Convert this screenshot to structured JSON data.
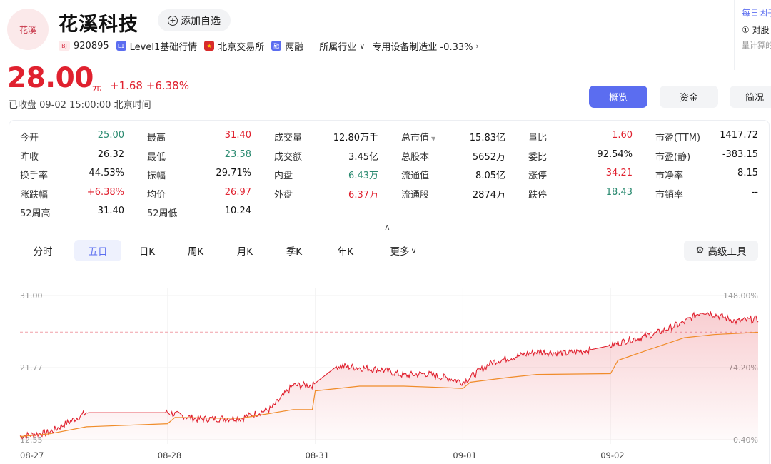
{
  "header": {
    "logo_text": "花溪",
    "name": "花溪科技",
    "watch_label": "添加自选",
    "meta": {
      "exchange_badge": "BJ",
      "code": "920895",
      "level_badge": "L1",
      "level": "Level1基础行情",
      "market": "北京交易所",
      "margin_badge": "融",
      "margin": "两融",
      "industry_label": "所属行业",
      "industry": "专用设备制造业 -0.33%"
    }
  },
  "right_panel": {
    "title": "每日因子",
    "line": "① 对股",
    "sub": "量计算的"
  },
  "quote": {
    "price": "28.00",
    "unit": "元",
    "change": "+1.68",
    "change_pct": "+6.38%",
    "status": "已收盘",
    "time": "09-02 15:00:00 北京时间"
  },
  "tabs": {
    "overview": "概览",
    "funds": "资金",
    "brief": "简况"
  },
  "stats": {
    "col1": [
      {
        "label": "今开",
        "value": "25.00",
        "color": "green"
      },
      {
        "label": "昨收",
        "value": "26.32",
        "color": ""
      },
      {
        "label": "换手率",
        "value": "44.53%",
        "color": ""
      },
      {
        "label": "涨跌幅",
        "value": "+6.38%",
        "color": "red"
      },
      {
        "label": "52周高",
        "value": "31.40",
        "color": ""
      }
    ],
    "col2": [
      {
        "label": "最高",
        "value": "31.40",
        "color": "red"
      },
      {
        "label": "最低",
        "value": "23.58",
        "color": "green"
      },
      {
        "label": "振幅",
        "value": "29.71%",
        "color": ""
      },
      {
        "label": "均价",
        "value": "26.97",
        "color": "red"
      },
      {
        "label": "52周低",
        "value": "10.24",
        "color": ""
      }
    ],
    "col3": [
      {
        "label": "成交量",
        "value": "12.80万手",
        "color": ""
      },
      {
        "label": "成交额",
        "value": "3.45亿",
        "color": ""
      },
      {
        "label": "内盘",
        "value": "6.43万",
        "color": "green"
      },
      {
        "label": "外盘",
        "value": "6.37万",
        "color": "red"
      }
    ],
    "col4": [
      {
        "label": "总市值",
        "value": "15.83亿",
        "color": ""
      },
      {
        "label": "总股本",
        "value": "5652万",
        "color": ""
      },
      {
        "label": "流通值",
        "value": "8.05亿",
        "color": ""
      },
      {
        "label": "流通股",
        "value": "2874万",
        "color": ""
      }
    ],
    "col5": [
      {
        "label": "量比",
        "value": "1.60",
        "color": "red"
      },
      {
        "label": "委比",
        "value": "92.54%",
        "color": ""
      },
      {
        "label": "涨停",
        "value": "34.21",
        "color": "red"
      },
      {
        "label": "跌停",
        "value": "18.43",
        "color": "green"
      }
    ],
    "col6": [
      {
        "label": "市盈(TTM)",
        "value": "1417.72",
        "color": ""
      },
      {
        "label": "市盈(静)",
        "value": "-383.15",
        "color": ""
      },
      {
        "label": "市净率",
        "value": "8.15",
        "color": ""
      },
      {
        "label": "市销率",
        "value": "--",
        "color": ""
      }
    ]
  },
  "period_tabs": [
    "分时",
    "五日",
    "日K",
    "周K",
    "月K",
    "季K",
    "年K",
    "更多"
  ],
  "active_period": "五日",
  "advanced_tools": "高级工具",
  "colors": {
    "up": "#e0212f",
    "down": "#2a8a70",
    "accent": "#5b6df0",
    "avg_line": "#f08c2a"
  },
  "chart_data": {
    "type": "line",
    "ylim": [
      12.55,
      31.0
    ],
    "y_ticks": [
      "31.00",
      "21.77",
      "12.55"
    ],
    "y2_ticks": [
      "148.00%",
      "74.20%",
      "0.40%"
    ],
    "x_labels": [
      "08-27",
      "08-28",
      "08-31",
      "09-01",
      "09-02"
    ],
    "prev_close": 26.32,
    "series": [
      {
        "key": "price",
        "x": [
          0,
          0.2,
          0.45,
          0.6,
          0.75,
          0.9,
          1.0,
          1.2,
          1.5,
          1.7,
          1.85,
          1.98,
          2.15,
          2.45,
          2.6,
          2.75,
          2.85,
          2.95,
          3.0,
          3.2,
          3.5,
          3.7,
          3.85,
          4.0,
          4.1,
          4.3,
          4.5,
          4.62,
          4.7,
          4.85,
          5.0
        ],
        "values": [
          13.0,
          13.5,
          16.0,
          16.0,
          16.0,
          16.0,
          16.0,
          15.2,
          15.3,
          16.5,
          19.5,
          19.5,
          22.0,
          21.5,
          20.8,
          21.0,
          20.6,
          20.2,
          19.9,
          22.5,
          23.8,
          23.6,
          24.0,
          24.6,
          25.2,
          26.1,
          27.6,
          29.0,
          28.6,
          27.7,
          28.0
        ]
      },
      {
        "key": "avg",
        "x": [
          0,
          0.2,
          0.45,
          1.0,
          1.05,
          1.35,
          1.5,
          1.85,
          1.98,
          2.0,
          2.3,
          2.6,
          2.9,
          3.0,
          3.05,
          3.3,
          3.5,
          4.0,
          4.05,
          4.25,
          4.5,
          4.7,
          5.0
        ],
        "values": [
          12.95,
          13.3,
          14.2,
          14.6,
          15.4,
          15.3,
          15.3,
          16.4,
          16.4,
          18.8,
          19.4,
          19.4,
          19.2,
          19.1,
          19.9,
          20.5,
          20.9,
          21.0,
          22.7,
          24.0,
          25.6,
          26.0,
          26.3
        ]
      }
    ]
  }
}
